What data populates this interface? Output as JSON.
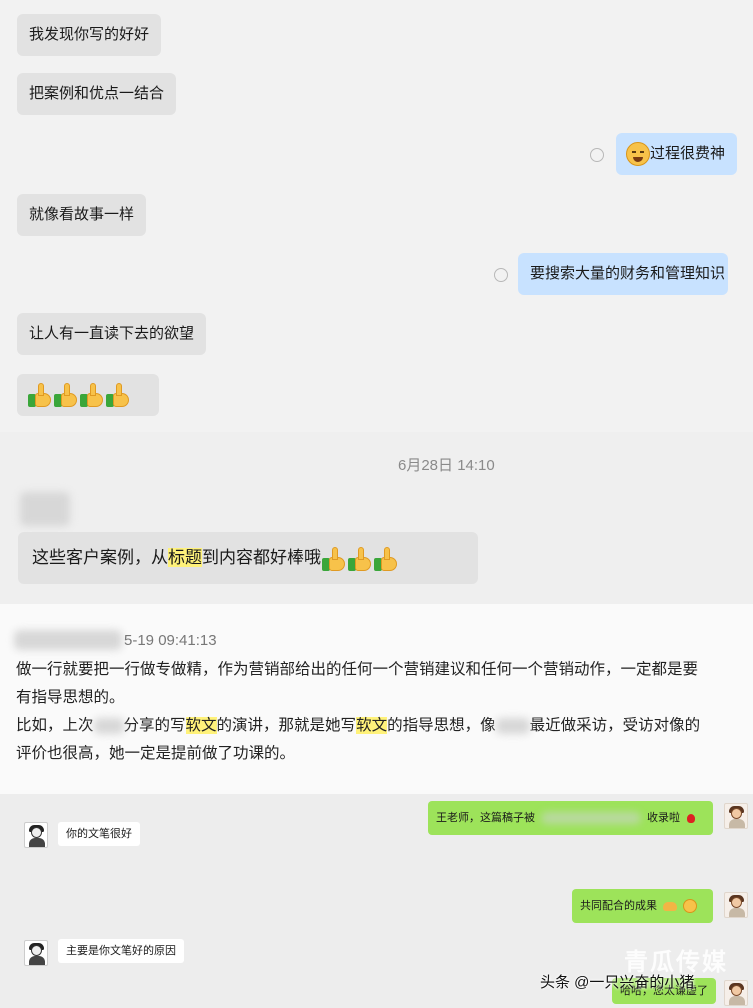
{
  "chat1": {
    "received": [
      "我发现你写的好好",
      "把案例和优点一结合",
      "就像看故事一样",
      "让人有一直读下去的欲望"
    ],
    "sent": [
      "过程很费神",
      "要搜索大量的财务和管理知识"
    ]
  },
  "chat2": {
    "timestamp": "6月28日 14:10",
    "message": {
      "before": "这些客户案例，从",
      "highlight": "标题",
      "after": "到内容都好棒哦"
    }
  },
  "post": {
    "time": "5-19 09:41:13",
    "line1": "做一行就要把一行做专做精，作为营销部给出的任何一个营销建议和任何一个营销动作，一定都是要",
    "line2": "有指导思想的。",
    "line3": {
      "p1": "比如，上次",
      "p2": "分享的写",
      "hl1": "软文",
      "p3": "的演讲，那就是她写",
      "hl2": "软文",
      "p4": "的指导思想，像",
      "p5": "最近做采访，受访对像的"
    },
    "line4": "评价也很高，她一定是提前做了功课的。"
  },
  "chat3": {
    "sent1": {
      "before": "王老师，这篇稿子被",
      "after": "收录啦"
    },
    "received1": "你的文笔很好",
    "sent2": "共同配合的成果",
    "received2": "主要是你文笔好的原因",
    "sent3": "哈哈，您太谦虚了"
  },
  "watermark": {
    "source": "头条 @一只兴奋的小猪",
    "brand": "青瓜传媒"
  },
  "colors": {
    "blue_bubble": "#c8e2ff",
    "gray_bubble": "#e2e2e2",
    "green_bubble": "#9de35a",
    "highlight": "#fff27a"
  }
}
